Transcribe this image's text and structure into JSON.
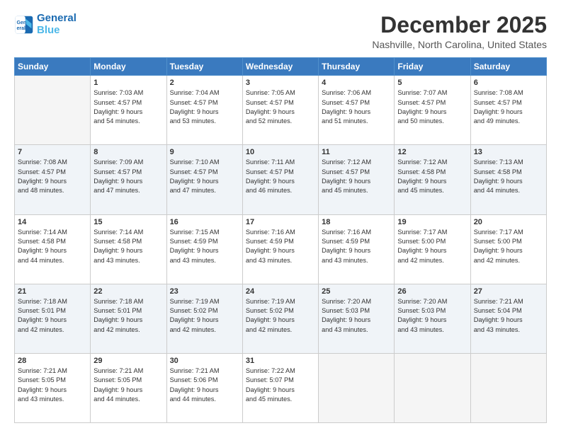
{
  "header": {
    "logo_line1": "General",
    "logo_line2": "Blue",
    "month": "December 2025",
    "location": "Nashville, North Carolina, United States"
  },
  "weekdays": [
    "Sunday",
    "Monday",
    "Tuesday",
    "Wednesday",
    "Thursday",
    "Friday",
    "Saturday"
  ],
  "weeks": [
    [
      {
        "day": "",
        "info": ""
      },
      {
        "day": "1",
        "info": "Sunrise: 7:03 AM\nSunset: 4:57 PM\nDaylight: 9 hours\nand 54 minutes."
      },
      {
        "day": "2",
        "info": "Sunrise: 7:04 AM\nSunset: 4:57 PM\nDaylight: 9 hours\nand 53 minutes."
      },
      {
        "day": "3",
        "info": "Sunrise: 7:05 AM\nSunset: 4:57 PM\nDaylight: 9 hours\nand 52 minutes."
      },
      {
        "day": "4",
        "info": "Sunrise: 7:06 AM\nSunset: 4:57 PM\nDaylight: 9 hours\nand 51 minutes."
      },
      {
        "day": "5",
        "info": "Sunrise: 7:07 AM\nSunset: 4:57 PM\nDaylight: 9 hours\nand 50 minutes."
      },
      {
        "day": "6",
        "info": "Sunrise: 7:08 AM\nSunset: 4:57 PM\nDaylight: 9 hours\nand 49 minutes."
      }
    ],
    [
      {
        "day": "7",
        "info": "Sunrise: 7:08 AM\nSunset: 4:57 PM\nDaylight: 9 hours\nand 48 minutes."
      },
      {
        "day": "8",
        "info": "Sunrise: 7:09 AM\nSunset: 4:57 PM\nDaylight: 9 hours\nand 47 minutes."
      },
      {
        "day": "9",
        "info": "Sunrise: 7:10 AM\nSunset: 4:57 PM\nDaylight: 9 hours\nand 47 minutes."
      },
      {
        "day": "10",
        "info": "Sunrise: 7:11 AM\nSunset: 4:57 PM\nDaylight: 9 hours\nand 46 minutes."
      },
      {
        "day": "11",
        "info": "Sunrise: 7:12 AM\nSunset: 4:57 PM\nDaylight: 9 hours\nand 45 minutes."
      },
      {
        "day": "12",
        "info": "Sunrise: 7:12 AM\nSunset: 4:58 PM\nDaylight: 9 hours\nand 45 minutes."
      },
      {
        "day": "13",
        "info": "Sunrise: 7:13 AM\nSunset: 4:58 PM\nDaylight: 9 hours\nand 44 minutes."
      }
    ],
    [
      {
        "day": "14",
        "info": "Sunrise: 7:14 AM\nSunset: 4:58 PM\nDaylight: 9 hours\nand 44 minutes."
      },
      {
        "day": "15",
        "info": "Sunrise: 7:14 AM\nSunset: 4:58 PM\nDaylight: 9 hours\nand 43 minutes."
      },
      {
        "day": "16",
        "info": "Sunrise: 7:15 AM\nSunset: 4:59 PM\nDaylight: 9 hours\nand 43 minutes."
      },
      {
        "day": "17",
        "info": "Sunrise: 7:16 AM\nSunset: 4:59 PM\nDaylight: 9 hours\nand 43 minutes."
      },
      {
        "day": "18",
        "info": "Sunrise: 7:16 AM\nSunset: 4:59 PM\nDaylight: 9 hours\nand 43 minutes."
      },
      {
        "day": "19",
        "info": "Sunrise: 7:17 AM\nSunset: 5:00 PM\nDaylight: 9 hours\nand 42 minutes."
      },
      {
        "day": "20",
        "info": "Sunrise: 7:17 AM\nSunset: 5:00 PM\nDaylight: 9 hours\nand 42 minutes."
      }
    ],
    [
      {
        "day": "21",
        "info": "Sunrise: 7:18 AM\nSunset: 5:01 PM\nDaylight: 9 hours\nand 42 minutes."
      },
      {
        "day": "22",
        "info": "Sunrise: 7:18 AM\nSunset: 5:01 PM\nDaylight: 9 hours\nand 42 minutes."
      },
      {
        "day": "23",
        "info": "Sunrise: 7:19 AM\nSunset: 5:02 PM\nDaylight: 9 hours\nand 42 minutes."
      },
      {
        "day": "24",
        "info": "Sunrise: 7:19 AM\nSunset: 5:02 PM\nDaylight: 9 hours\nand 42 minutes."
      },
      {
        "day": "25",
        "info": "Sunrise: 7:20 AM\nSunset: 5:03 PM\nDaylight: 9 hours\nand 43 minutes."
      },
      {
        "day": "26",
        "info": "Sunrise: 7:20 AM\nSunset: 5:03 PM\nDaylight: 9 hours\nand 43 minutes."
      },
      {
        "day": "27",
        "info": "Sunrise: 7:21 AM\nSunset: 5:04 PM\nDaylight: 9 hours\nand 43 minutes."
      }
    ],
    [
      {
        "day": "28",
        "info": "Sunrise: 7:21 AM\nSunset: 5:05 PM\nDaylight: 9 hours\nand 43 minutes."
      },
      {
        "day": "29",
        "info": "Sunrise: 7:21 AM\nSunset: 5:05 PM\nDaylight: 9 hours\nand 44 minutes."
      },
      {
        "day": "30",
        "info": "Sunrise: 7:21 AM\nSunset: 5:06 PM\nDaylight: 9 hours\nand 44 minutes."
      },
      {
        "day": "31",
        "info": "Sunrise: 7:22 AM\nSunset: 5:07 PM\nDaylight: 9 hours\nand 45 minutes."
      },
      {
        "day": "",
        "info": ""
      },
      {
        "day": "",
        "info": ""
      },
      {
        "day": "",
        "info": ""
      }
    ]
  ]
}
